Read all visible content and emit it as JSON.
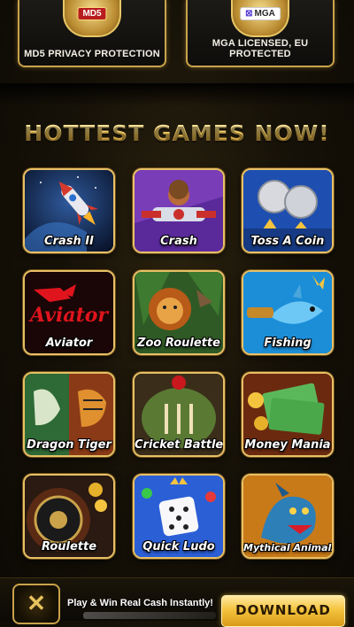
{
  "badges": [
    {
      "emblem_text": "MD5",
      "label": "MD5 PRIVACY PROTECTION"
    },
    {
      "emblem_text": "MGA",
      "label": "MGA LICENSED, EU PROTECTED"
    }
  ],
  "headline": "HOTTEST GAMES NOW!",
  "games": [
    {
      "name": "Crash II",
      "icon": "rocket-icon"
    },
    {
      "name": "Crash",
      "icon": "plane-pilot-icon"
    },
    {
      "name": "Toss A Coin",
      "icon": "coin-icon"
    },
    {
      "name": "Aviator",
      "icon": "aviator-logo-icon"
    },
    {
      "name": "Zoo Roulette",
      "icon": "lion-icon"
    },
    {
      "name": "Fishing",
      "icon": "shark-icon"
    },
    {
      "name": "Dragon Tiger",
      "icon": "dragon-tiger-icon"
    },
    {
      "name": "Cricket Battle",
      "icon": "cricket-ball-icon"
    },
    {
      "name": "Money Mania",
      "icon": "money-stack-icon"
    },
    {
      "name": "Roulette",
      "icon": "roulette-wheel-icon"
    },
    {
      "name": "Quick Ludo",
      "icon": "dice-icon"
    },
    {
      "name": "Mythical Animals",
      "icon": "dragon-icon"
    }
  ],
  "footer": {
    "tagline": "Play & Win Real Cash Instantly!",
    "download_label": "DOWNLOAD"
  },
  "colors": {
    "accent": "#e7c067",
    "background": "#171208",
    "button": "#f4c43f"
  }
}
